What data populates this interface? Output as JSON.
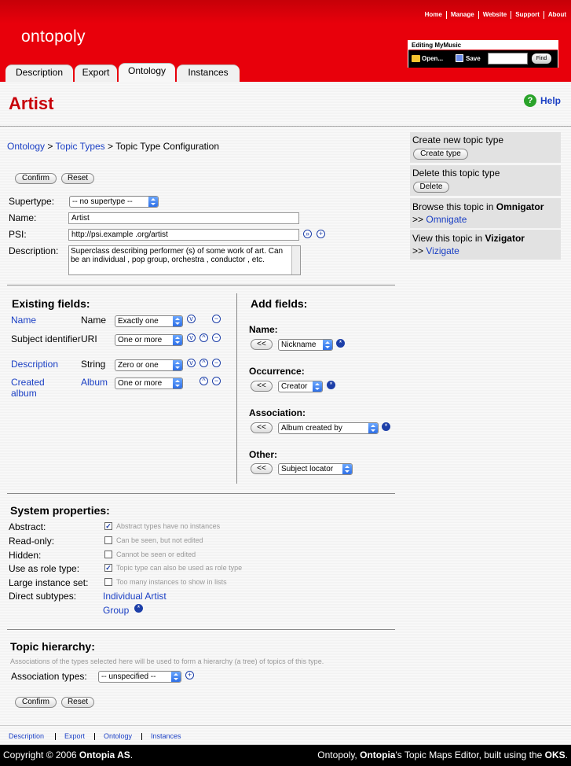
{
  "app": {
    "logo": "ontopoly",
    "title": "Artist",
    "help": "Help"
  },
  "topnav": [
    "Home",
    "Manage",
    "Website",
    "Support",
    "About"
  ],
  "editor": {
    "title": "Editing MyMusic",
    "open": "Open...",
    "save": "Save",
    "find": "Find"
  },
  "tabs": [
    "Description",
    "Export",
    "Ontology",
    "Instances"
  ],
  "breadcrumb": {
    "b1": "Ontology",
    "sep1": ">",
    "b2": "Topic Types",
    "sep2": ">",
    "b3": "Topic Type Configuration"
  },
  "buttons": {
    "confirm": "Confirm",
    "reset": "Reset",
    "create": "Create type",
    "delete": "Delete",
    "add": "<<"
  },
  "form": {
    "supertype_label": "Supertype:",
    "supertype": "-- no supertype --",
    "name_label": "Name:",
    "name": "Artist",
    "psi_label": "PSI:",
    "psi": "http://psi.example .org/artist",
    "desc_label": "Description:",
    "desc": "Superclass  describing  performer (s) of some  work of art. Can be an individual , pop group, orchestra , conductor , etc."
  },
  "existing": {
    "heading": "Existing fields:",
    "rows": [
      {
        "field": "Name",
        "type": "Name",
        "card": "Exactly one"
      },
      {
        "field": "Subject identifier",
        "type": "URI",
        "card": "One or more"
      },
      {
        "field": "Description",
        "type": "String",
        "card": "Zero or one"
      },
      {
        "field": "Created album",
        "type": "Album",
        "card": "One or more"
      }
    ]
  },
  "add": {
    "heading": "Add fields:",
    "name_label": "Name:",
    "name": "Nickname",
    "occ_label": "Occurrence:",
    "occ": "Creator",
    "assoc_label": "Association:",
    "assoc": "Album created by",
    "other_label": "Other:",
    "other": "Subject locator"
  },
  "system": {
    "heading": "System properties:",
    "rows": [
      {
        "label": "Abstract:",
        "checked": true,
        "hint": "Abstract types have no instances"
      },
      {
        "label": "Read-only:",
        "checked": false,
        "hint": "Can be seen, but not edited"
      },
      {
        "label": "Hidden:",
        "checked": false,
        "hint": "Cannot be seen or edited"
      },
      {
        "label": "Use as role type:",
        "checked": true,
        "hint": "Topic type can also be used as role type"
      },
      {
        "label": "Large instance set:",
        "checked": false,
        "hint": "Too many instances to show in lists"
      }
    ],
    "subtypes_label": "Direct subtypes:",
    "subtypes": [
      "Individual Artist",
      "Group"
    ]
  },
  "hierarchy": {
    "heading": "Topic hierarchy:",
    "hint": "Associations of the types selected here will be used to form a hierarchy (a tree) of topics of this type.",
    "assoc_label": "Association types:",
    "assoc": "-- unspecified --"
  },
  "sidebar": {
    "create": "Create new topic type",
    "delete": "Delete this topic type",
    "omni_text": "Browse this topic in",
    "omni_bold": "Omnigator",
    "omni_link": "Omnigate",
    "viz_text": "View this topic in",
    "viz_bold": "Vizigator",
    "viz_link": "Vizigate",
    "arrow": ">>"
  },
  "footer_nav": [
    "Description",
    "Export",
    "Ontology",
    "Instances"
  ],
  "footer": {
    "copy": "Copyright © 2006",
    "copy_bold": "Ontopia AS",
    "right1": "Ontopoly,",
    "right2": "Ontopia",
    "right3": "'s Topic Maps Editor, built using the",
    "right4": "OKS"
  }
}
